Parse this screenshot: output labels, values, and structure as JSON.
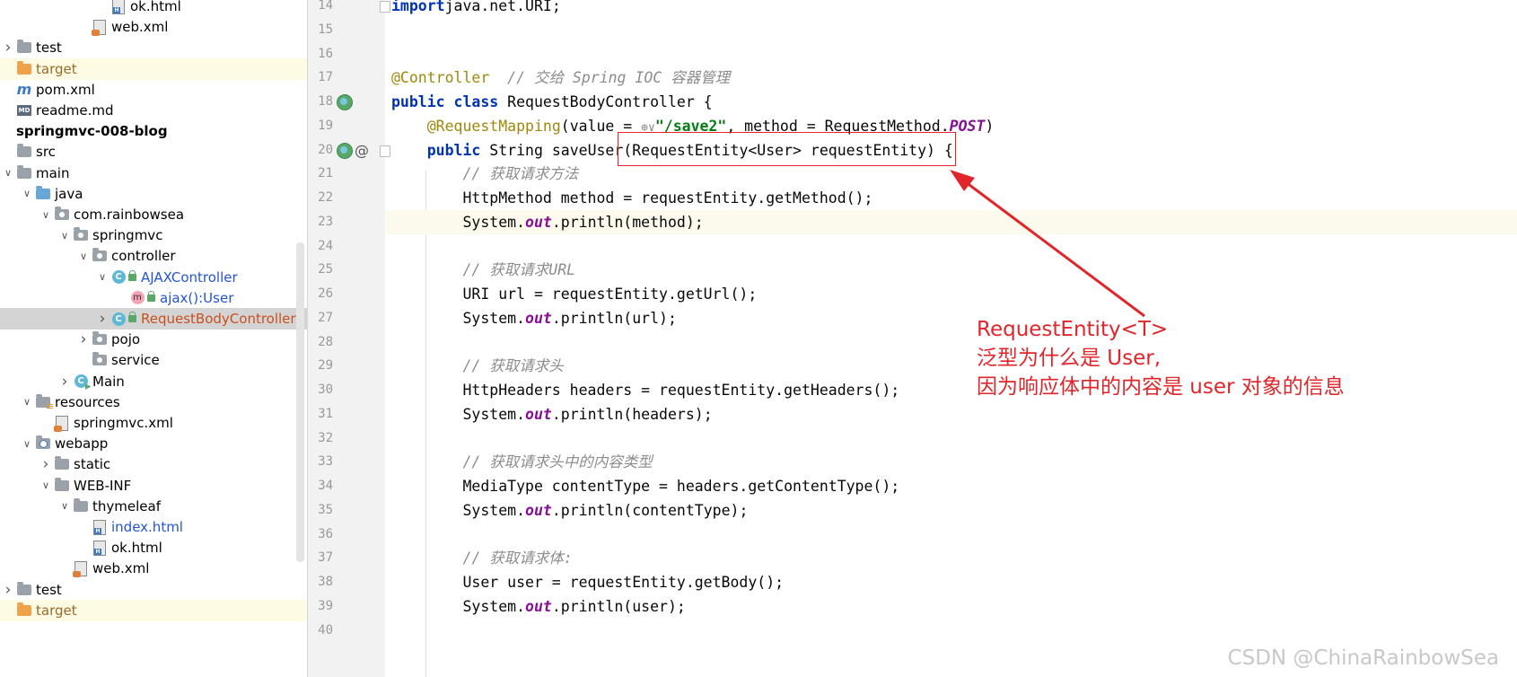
{
  "project_tree": {
    "rows": [
      {
        "label": "ok.html",
        "depth": 5,
        "chevron": "none",
        "icon": "html-file",
        "style": ""
      },
      {
        "label": "web.xml",
        "depth": 4,
        "chevron": "none",
        "icon": "xml-file",
        "style": ""
      },
      {
        "label": "test",
        "depth": 0,
        "chevron": "collapsed",
        "icon": "folder",
        "style": ""
      },
      {
        "label": "target",
        "depth": 0,
        "chevron": "none",
        "icon": "folder-orange",
        "style": "target",
        "highlight": true
      },
      {
        "label": "pom.xml",
        "depth": 0,
        "chevron": "none",
        "icon": "maven-file",
        "style": ""
      },
      {
        "label": "readme.md",
        "depth": 0,
        "chevron": "none",
        "icon": "markdown-file",
        "style": ""
      },
      {
        "label": "springmvc-008-blog",
        "depth": 0,
        "chevron": "none",
        "icon": "",
        "style": "project"
      },
      {
        "label": "src",
        "depth": 0,
        "chevron": "none",
        "icon": "folder",
        "style": ""
      },
      {
        "label": "main",
        "depth": 0,
        "chevron": "expanded",
        "icon": "folder",
        "style": ""
      },
      {
        "label": "java",
        "depth": 1,
        "chevron": "expanded",
        "icon": "folder-blue",
        "style": ""
      },
      {
        "label": "com.rainbowsea",
        "depth": 2,
        "chevron": "expanded",
        "icon": "package",
        "style": ""
      },
      {
        "label": "springmvc",
        "depth": 3,
        "chevron": "expanded",
        "icon": "package",
        "style": ""
      },
      {
        "label": "controller",
        "depth": 4,
        "chevron": "expanded",
        "icon": "package",
        "style": ""
      },
      {
        "label": "AJAXController",
        "depth": 5,
        "chevron": "expanded",
        "icon": "class",
        "style": "blue"
      },
      {
        "label": "ajax():User",
        "depth": 6,
        "chevron": "none",
        "icon": "method",
        "style": "blue"
      },
      {
        "label": "RequestBodyController",
        "depth": 5,
        "chevron": "collapsed",
        "icon": "class",
        "style": "orange",
        "selected": true
      },
      {
        "label": "pojo",
        "depth": 4,
        "chevron": "collapsed",
        "icon": "package",
        "style": ""
      },
      {
        "label": "service",
        "depth": 4,
        "chevron": "none",
        "icon": "package",
        "style": ""
      },
      {
        "label": "Main",
        "depth": 3,
        "chevron": "collapsed",
        "icon": "main-class",
        "style": ""
      },
      {
        "label": "resources",
        "depth": 1,
        "chevron": "expanded",
        "icon": "resources-folder",
        "style": ""
      },
      {
        "label": "springmvc.xml",
        "depth": 2,
        "chevron": "none",
        "icon": "xml-file",
        "style": ""
      },
      {
        "label": "webapp",
        "depth": 1,
        "chevron": "expanded",
        "icon": "web-folder",
        "style": ""
      },
      {
        "label": "static",
        "depth": 2,
        "chevron": "collapsed",
        "icon": "folder",
        "style": ""
      },
      {
        "label": "WEB-INF",
        "depth": 2,
        "chevron": "expanded",
        "icon": "folder",
        "style": ""
      },
      {
        "label": "thymeleaf",
        "depth": 3,
        "chevron": "expanded",
        "icon": "folder",
        "style": ""
      },
      {
        "label": "index.html",
        "depth": 4,
        "chevron": "none",
        "icon": "html-file",
        "style": "blue"
      },
      {
        "label": "ok.html",
        "depth": 4,
        "chevron": "none",
        "icon": "html-file",
        "style": ""
      },
      {
        "label": "web.xml",
        "depth": 3,
        "chevron": "none",
        "icon": "xml-file",
        "style": ""
      },
      {
        "label": "test",
        "depth": 0,
        "chevron": "collapsed",
        "icon": "folder",
        "style": ""
      },
      {
        "label": "target",
        "depth": 0,
        "chevron": "none",
        "icon": "folder-orange",
        "style": "target",
        "highlight": true
      }
    ]
  },
  "editor": {
    "current_line": "23",
    "lines": [
      {
        "num": "14",
        "gutter": [],
        "tokens": [
          [
            "kw",
            "import"
          ],
          [
            "",
            "java.net.URI;"
          ]
        ]
      },
      {
        "num": "15",
        "gutter": [],
        "tokens": []
      },
      {
        "num": "16",
        "gutter": [],
        "tokens": []
      },
      {
        "num": "17",
        "gutter": [],
        "tokens": [
          [
            "ann",
            "@Controller"
          ],
          [
            "",
            "  "
          ],
          [
            "cmt",
            "// 交给 Spring IOC 容器管理"
          ]
        ]
      },
      {
        "num": "18",
        "gutter": [
          "bean-icon"
        ],
        "tokens": [
          [
            "kw",
            "public class "
          ],
          [
            "",
            "RequestBodyController {"
          ]
        ]
      },
      {
        "num": "19",
        "gutter": [],
        "tokens": [
          [
            "",
            "    "
          ],
          [
            "ann",
            "@RequestMapping"
          ],
          [
            "",
            "(value = "
          ],
          [
            "globe",
            "⊕∨"
          ],
          [
            "str",
            "\"/save2\""
          ],
          [
            "",
            ", method = RequestMethod."
          ],
          [
            "fld",
            "POST"
          ],
          [
            "",
            ")"
          ]
        ]
      },
      {
        "num": "20",
        "gutter": [
          "bean-icon",
          "at-icon"
        ],
        "tokens": [
          [
            "",
            "    "
          ],
          [
            "kw",
            "public "
          ],
          [
            "",
            "String saveUser(RequestEntity<User> requestEntity) {"
          ]
        ]
      },
      {
        "num": "21",
        "gutter": [],
        "tokens": [
          [
            "",
            "        "
          ],
          [
            "cmt",
            "// 获取请求方法"
          ]
        ]
      },
      {
        "num": "22",
        "gutter": [],
        "tokens": [
          [
            "",
            "        HttpMethod method = requestEntity.getMethod();"
          ]
        ]
      },
      {
        "num": "23",
        "gutter": [],
        "tokens": [
          [
            "",
            "        System."
          ],
          [
            "fld",
            "out"
          ],
          [
            "",
            ".println(method);"
          ]
        ]
      },
      {
        "num": "24",
        "gutter": [],
        "tokens": []
      },
      {
        "num": "25",
        "gutter": [],
        "tokens": [
          [
            "",
            "        "
          ],
          [
            "cmt",
            "// 获取请求URL"
          ]
        ]
      },
      {
        "num": "26",
        "gutter": [],
        "tokens": [
          [
            "",
            "        URI url = requestEntity.getUrl();"
          ]
        ]
      },
      {
        "num": "27",
        "gutter": [],
        "tokens": [
          [
            "",
            "        System."
          ],
          [
            "fld",
            "out"
          ],
          [
            "",
            ".println(url);"
          ]
        ]
      },
      {
        "num": "28",
        "gutter": [],
        "tokens": []
      },
      {
        "num": "29",
        "gutter": [],
        "tokens": [
          [
            "",
            "        "
          ],
          [
            "cmt",
            "// 获取请求头"
          ]
        ]
      },
      {
        "num": "30",
        "gutter": [],
        "tokens": [
          [
            "",
            "        HttpHeaders headers = requestEntity.getHeaders();"
          ]
        ]
      },
      {
        "num": "31",
        "gutter": [],
        "tokens": [
          [
            "",
            "        System."
          ],
          [
            "fld",
            "out"
          ],
          [
            "",
            ".println(headers);"
          ]
        ]
      },
      {
        "num": "32",
        "gutter": [],
        "tokens": []
      },
      {
        "num": "33",
        "gutter": [],
        "tokens": [
          [
            "",
            "        "
          ],
          [
            "cmt",
            "// 获取请求头中的内容类型"
          ]
        ]
      },
      {
        "num": "34",
        "gutter": [],
        "tokens": [
          [
            "",
            "        MediaType contentType = headers.getContentType();"
          ]
        ]
      },
      {
        "num": "35",
        "gutter": [],
        "tokens": [
          [
            "",
            "        System."
          ],
          [
            "fld",
            "out"
          ],
          [
            "",
            ".println(contentType);"
          ]
        ]
      },
      {
        "num": "36",
        "gutter": [],
        "tokens": []
      },
      {
        "num": "37",
        "gutter": [],
        "tokens": [
          [
            "",
            "        "
          ],
          [
            "cmt",
            "// 获取请求体:"
          ]
        ]
      },
      {
        "num": "38",
        "gutter": [],
        "tokens": [
          [
            "",
            "        User user = requestEntity.getBody();"
          ]
        ]
      },
      {
        "num": "39",
        "gutter": [],
        "tokens": [
          [
            "",
            "        System."
          ],
          [
            "fld",
            "out"
          ],
          [
            "",
            ".println(user);"
          ]
        ]
      },
      {
        "num": "40",
        "gutter": [],
        "tokens": []
      }
    ]
  },
  "annotation": {
    "color": "#e0262a",
    "lines": [
      "RequestEntity<T>",
      "泛型为什么是 User,",
      "因为响应体中的内容是 user 对象的信息"
    ]
  },
  "watermark": "CSDN @ChinaRainbowSea"
}
